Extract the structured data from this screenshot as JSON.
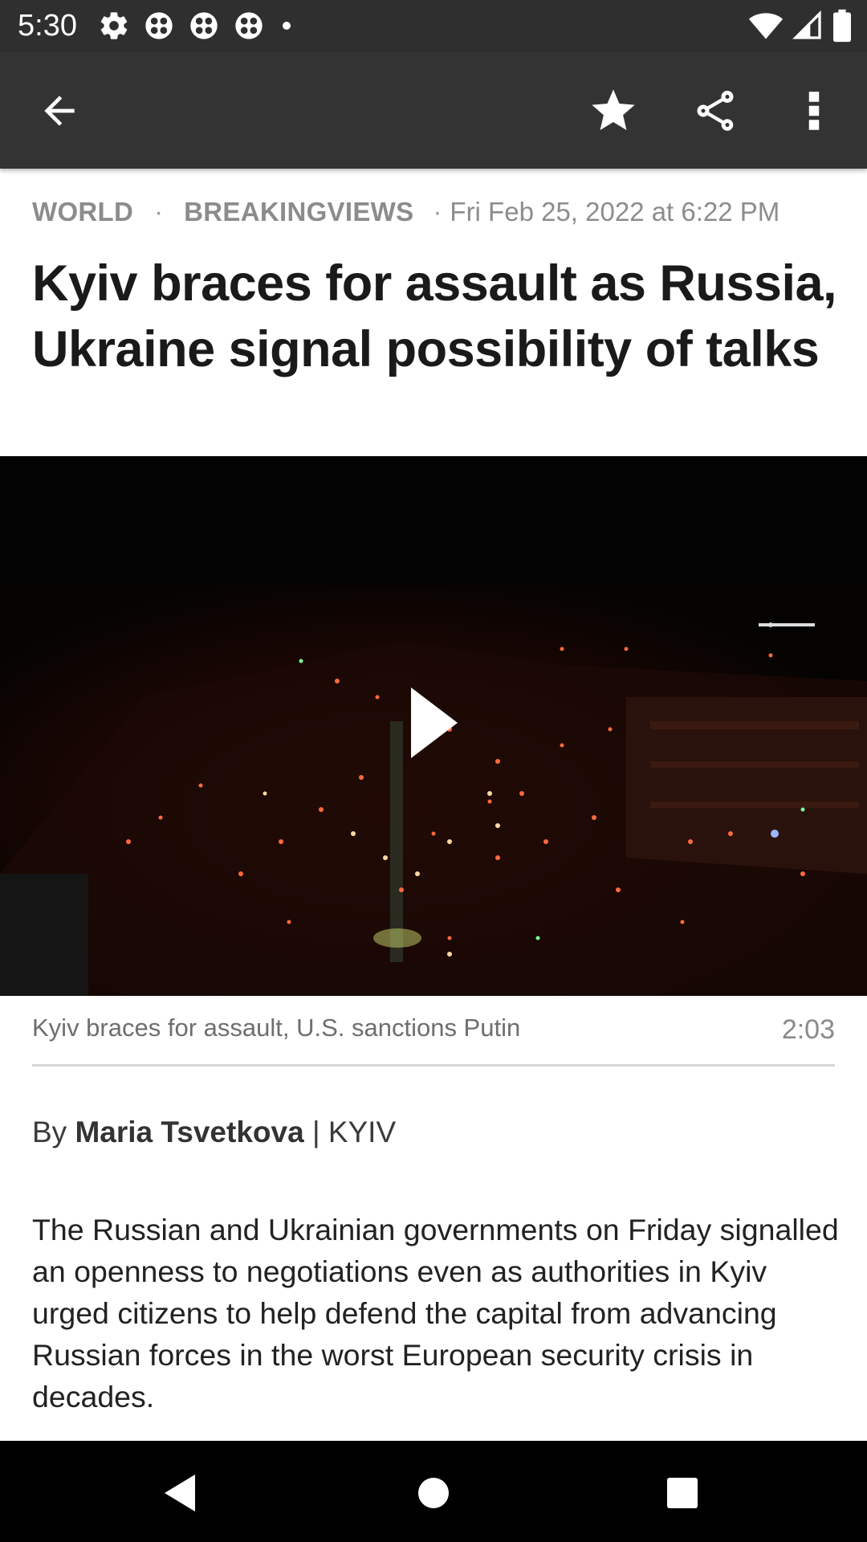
{
  "status_bar": {
    "time": "5:30",
    "left_icons": [
      "settings-icon",
      "app-icon",
      "app-icon",
      "app-icon",
      "dot-icon"
    ],
    "right_icons": [
      "wifi-icon",
      "signal-icon",
      "battery-icon"
    ]
  },
  "app_bar": {
    "icons": [
      "back-arrow-icon",
      "star-icon",
      "share-icon",
      "more-vert-icon"
    ]
  },
  "article": {
    "category_1": "WORLD",
    "category_2": "BREAKINGVIEWS",
    "separator": "·",
    "date": "Fri Feb 25, 2022 at 6:22 PM",
    "headline": "Kyiv braces for assault as Russia, Ukraine signal possibility of talks",
    "video": {
      "caption": "Kyiv braces for assault, U.S. sanctions Putin",
      "duration": "2:03",
      "icon": "play-icon"
    },
    "byline_prefix": "By",
    "author": "Maria Tsvetkova",
    "byline_suffix": "| KYIV",
    "body": "The Russian and Ukrainian governments on Friday signalled an openness to negotiations even as authorities in Kyiv urged citizens to help defend the capital from advancing Russian forces in the worst European security crisis in decades."
  },
  "nav_bar": {
    "icons": [
      "nav-back-icon",
      "nav-home-icon",
      "nav-recents-icon"
    ]
  },
  "colors": {
    "status_bar": "#2f2f2f",
    "app_bar": "#333333",
    "meta_text": "#8c8c8c",
    "headline": "#1a1a1a",
    "nav_bar": "#000000"
  }
}
